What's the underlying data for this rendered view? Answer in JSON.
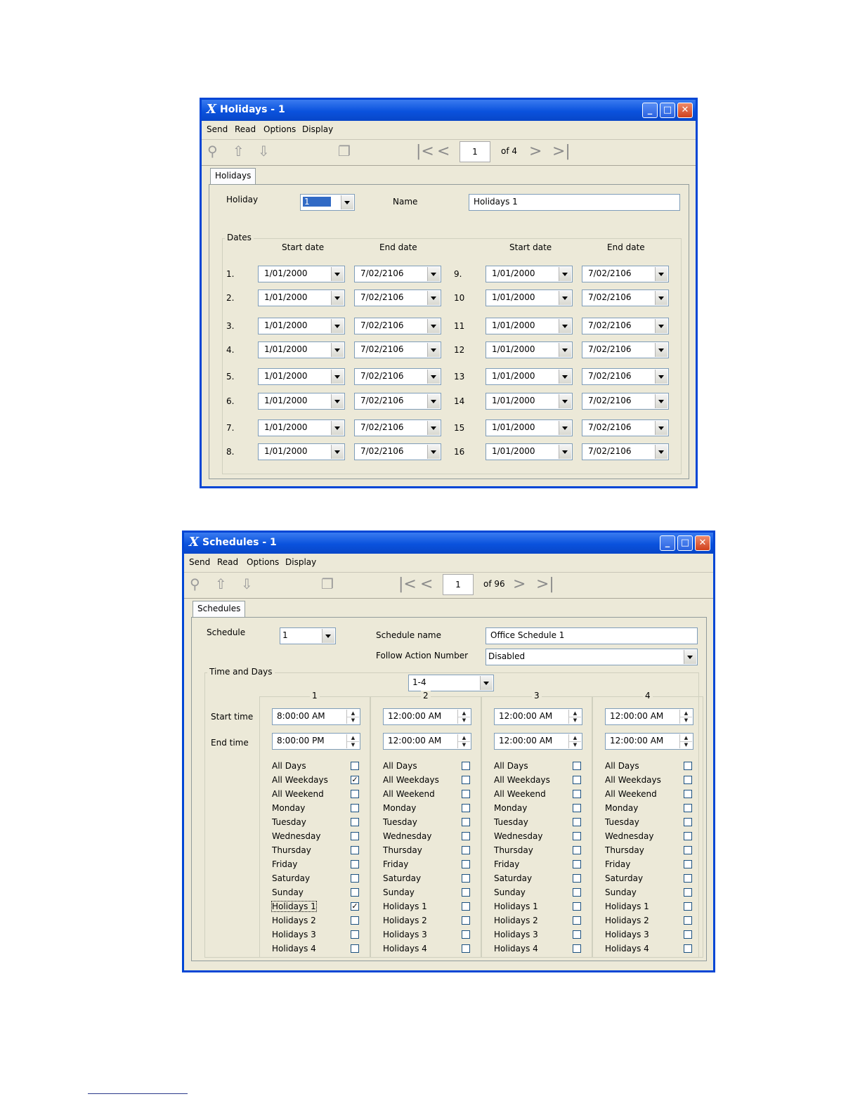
{
  "holidays_window": {
    "title": "Holidays - 1",
    "menu": [
      "Send",
      "Read",
      "Options",
      "Display"
    ],
    "page": "1",
    "of": "of 4",
    "tab": "Holidays",
    "holiday_label": "Holiday",
    "holiday_value": "1",
    "name_label": "Name",
    "name_value": "Holidays 1",
    "dates_legend": "Dates",
    "start_header": "Start date",
    "end_header": "End date",
    "rows": [
      {
        "n": "1.",
        "start": "1/01/2000",
        "end": "7/02/2106"
      },
      {
        "n": "2.",
        "start": "1/01/2000",
        "end": "7/02/2106"
      },
      {
        "n": "3.",
        "start": "1/01/2000",
        "end": "7/02/2106"
      },
      {
        "n": "4.",
        "start": "1/01/2000",
        "end": "7/02/2106"
      },
      {
        "n": "5.",
        "start": "1/01/2000",
        "end": "7/02/2106"
      },
      {
        "n": "6.",
        "start": "1/01/2000",
        "end": "7/02/2106"
      },
      {
        "n": "7.",
        "start": "1/01/2000",
        "end": "7/02/2106"
      },
      {
        "n": "8.",
        "start": "1/01/2000",
        "end": "7/02/2106"
      },
      {
        "n": "9.",
        "start": "1/01/2000",
        "end": "7/02/2106"
      },
      {
        "n": "10",
        "start": "1/01/2000",
        "end": "7/02/2106"
      },
      {
        "n": "11",
        "start": "1/01/2000",
        "end": "7/02/2106"
      },
      {
        "n": "12",
        "start": "1/01/2000",
        "end": "7/02/2106"
      },
      {
        "n": "13",
        "start": "1/01/2000",
        "end": "7/02/2106"
      },
      {
        "n": "14",
        "start": "1/01/2000",
        "end": "7/02/2106"
      },
      {
        "n": "15",
        "start": "1/01/2000",
        "end": "7/02/2106"
      },
      {
        "n": "16",
        "start": "1/01/2000",
        "end": "7/02/2106"
      }
    ]
  },
  "schedules_window": {
    "title": "Schedules - 1",
    "menu": [
      "Send",
      "Read",
      "Options",
      "Display"
    ],
    "page": "1",
    "of": "of 96",
    "tab": "Schedules",
    "schedule_label": "Schedule",
    "schedule_value": "1",
    "schedule_name_label": "Schedule name",
    "schedule_name_value": "Office Schedule 1",
    "follow_label": "Follow Action Number",
    "follow_value": "Disabled",
    "time_days_legend": "Time and Days",
    "range_value": "1-4",
    "start_time_label": "Start time",
    "end_time_label": "End time",
    "day_labels": [
      "All Days",
      "All Weekdays",
      "All Weekend",
      "Monday",
      "Tuesday",
      "Wednesday",
      "Thursday",
      "Friday",
      "Saturday",
      "Sunday",
      "Holidays 1",
      "Holidays 2",
      "Holidays 3",
      "Holidays 4"
    ],
    "columns": [
      {
        "header": "1",
        "start": "8:00:00 AM",
        "end": "8:00:00 PM",
        "checked": [
          false,
          true,
          false,
          false,
          false,
          false,
          false,
          false,
          false,
          false,
          true,
          false,
          false,
          false
        ]
      },
      {
        "header": "2",
        "start": "12:00:00 AM",
        "end": "12:00:00 AM",
        "checked": [
          false,
          false,
          false,
          false,
          false,
          false,
          false,
          false,
          false,
          false,
          false,
          false,
          false,
          false
        ]
      },
      {
        "header": "3",
        "start": "12:00:00 AM",
        "end": "12:00:00 AM",
        "checked": [
          false,
          false,
          false,
          false,
          false,
          false,
          false,
          false,
          false,
          false,
          false,
          false,
          false,
          false
        ]
      },
      {
        "header": "4",
        "start": "12:00:00 AM",
        "end": "12:00:00 AM",
        "checked": [
          false,
          false,
          false,
          false,
          false,
          false,
          false,
          false,
          false,
          false,
          false,
          false,
          false,
          false
        ]
      }
    ]
  }
}
